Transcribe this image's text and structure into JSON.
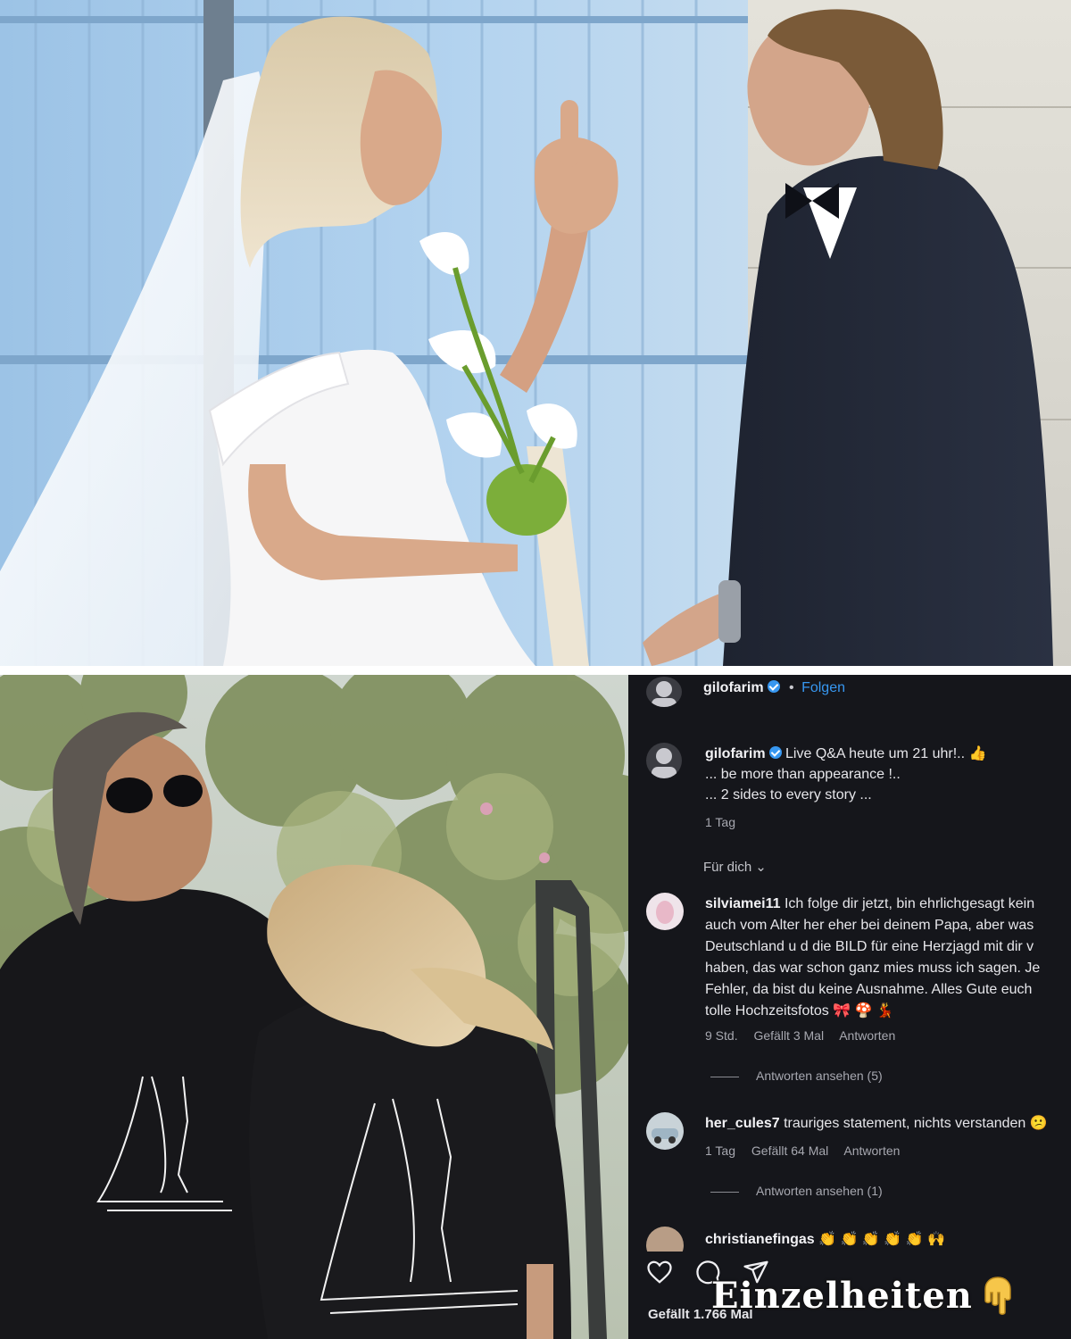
{
  "post": {
    "author": "gilofarim",
    "separator": "•",
    "follow_label": "Folgen",
    "caption_line1": "Live Q&A heute um 21 uhr!..",
    "caption_line2": "... be more than appearance !..",
    "caption_line3": "... 2 sides to every story ...",
    "caption_time": "1 Tag",
    "sort_label": "Für dich",
    "likes": "Gefällt 1.766 Mal"
  },
  "comments": [
    {
      "user": "silviamei11",
      "lines": [
        "Ich folge dir jetzt, bin ehrlichgesagt kein",
        "auch vom Alter her eher bei deinem Papa, aber was",
        "Deutschland u d die BILD für eine Herzjagd mit dir v",
        "haben, das war schon ganz mies muss ich sagen. Je",
        "Fehler, da bist du keine Ausnahme. Alles Gute euch",
        "tolle Hochzeitsfotos 🎀 🍄 💃"
      ],
      "time": "9 Std.",
      "likes": "Gefällt 3 Mal",
      "reply": "Antworten",
      "view_replies": "Antworten ansehen (5)"
    },
    {
      "user": "her_cules7",
      "text": "trauriges statement, nichts verstanden 😕",
      "time": "1 Tag",
      "likes": "Gefällt 64 Mal",
      "reply": "Antworten",
      "view_replies": "Antworten ansehen (1)"
    },
    {
      "user": "christianefingas",
      "text": "👏 👏 👏 👏 👏 🙌"
    }
  ],
  "overlay": {
    "label": "Einzelheiten",
    "emoji": "👇"
  },
  "icons": [
    "heart-icon",
    "comment-icon",
    "share-icon",
    "verified-icon",
    "chevron-down-icon",
    "pointing-down-icon"
  ],
  "colors": {
    "panel_bg": "#15161b",
    "link_blue": "#3797f0",
    "text": "#e6e6ea",
    "muted": "#a7a8b0"
  }
}
